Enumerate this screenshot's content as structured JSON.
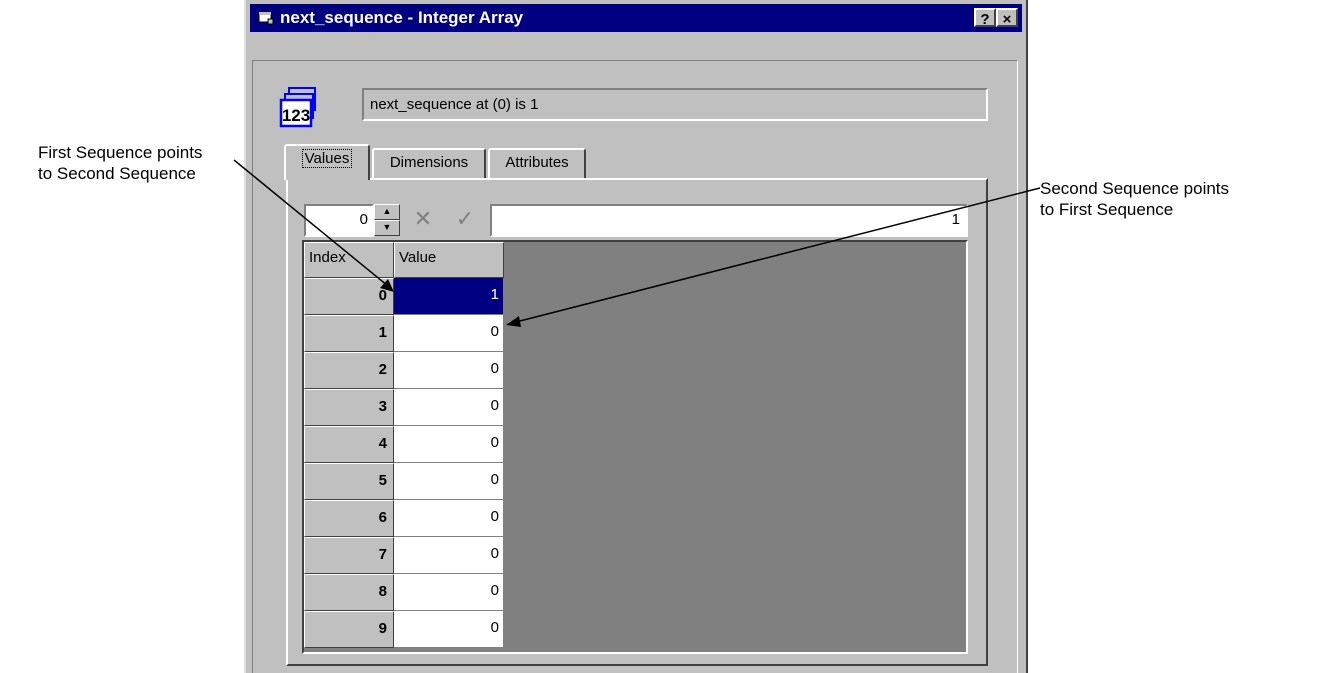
{
  "window": {
    "title": "next_sequence - Integer Array",
    "help_button": "?",
    "close_button": "×"
  },
  "header": {
    "icon_text": "123",
    "status": "next_sequence at (0) is 1"
  },
  "tabs": [
    {
      "label": "Values"
    },
    {
      "label": "Dimensions"
    },
    {
      "label": "Attributes"
    }
  ],
  "toolbar": {
    "index_value": "0",
    "cancel_icon": "x-icon",
    "accept_icon": "check-icon",
    "edit_value": "1"
  },
  "table": {
    "columns": [
      "Index",
      "Value"
    ],
    "rows": [
      {
        "index": "0",
        "value": "1"
      },
      {
        "index": "1",
        "value": "0"
      },
      {
        "index": "2",
        "value": "0"
      },
      {
        "index": "3",
        "value": "0"
      },
      {
        "index": "4",
        "value": "0"
      },
      {
        "index": "5",
        "value": "0"
      },
      {
        "index": "6",
        "value": "0"
      },
      {
        "index": "7",
        "value": "0"
      },
      {
        "index": "8",
        "value": "0"
      },
      {
        "index": "9",
        "value": "0"
      }
    ]
  },
  "annotations": {
    "left_line1": "First Sequence points",
    "left_line2": "to Second Sequence",
    "right_line1": "Second Sequence points",
    "right_line2": "to First Sequence"
  }
}
